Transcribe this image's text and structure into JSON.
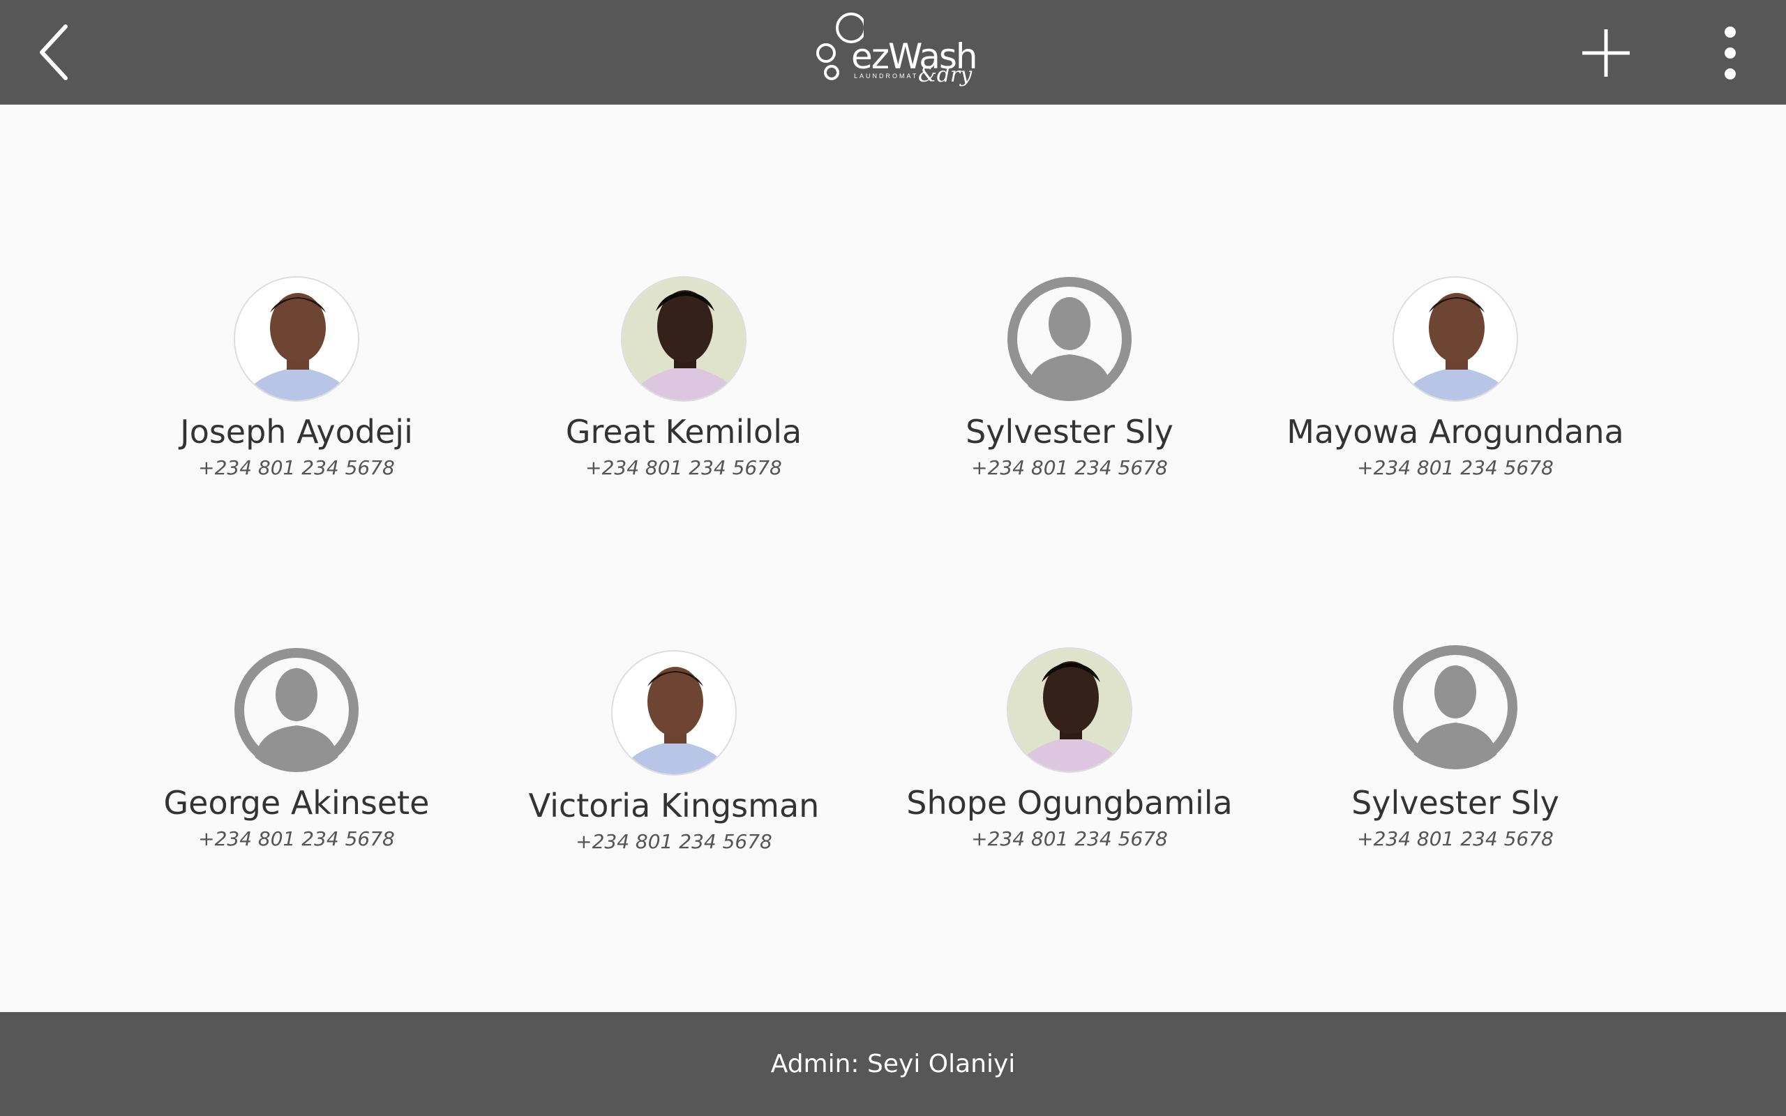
{
  "header": {
    "logo": {
      "brand": "ezWash",
      "tagline": "LAUNDROMAT",
      "script": "&dry"
    },
    "icons": {
      "back": "chevron-left-icon",
      "add": "plus-icon",
      "more": "more-vertical-icon"
    },
    "background_color": "#575757"
  },
  "contacts": [
    {
      "name": "Joseph Ayodeji",
      "phone": "+234 801 234 5678",
      "avatar": "photo"
    },
    {
      "name": "Great Kemilola",
      "phone": "+234 801 234 5678",
      "avatar": "photo"
    },
    {
      "name": "Sylvester Sly",
      "phone": "+234 801 234 5678",
      "avatar": "placeholder-person-icon"
    },
    {
      "name": "Mayowa Arogundana",
      "phone": "+234 801 234 5678",
      "avatar": "photo"
    },
    {
      "name": "George Akinsete",
      "phone": "+234 801 234 5678",
      "avatar": "placeholder-person-icon"
    },
    {
      "name": "Victoria Kingsman",
      "phone": "+234 801 234 5678",
      "avatar": "photo"
    },
    {
      "name": "Shope Ogungbamila",
      "phone": "+234 801 234 5678",
      "avatar": "photo"
    },
    {
      "name": "Sylvester Sly",
      "phone": "+234 801 234 5678",
      "avatar": "placeholder-person-icon"
    }
  ],
  "footer": {
    "admin_label": "Admin: Seyi Olaniyi",
    "background_color": "#575757"
  }
}
